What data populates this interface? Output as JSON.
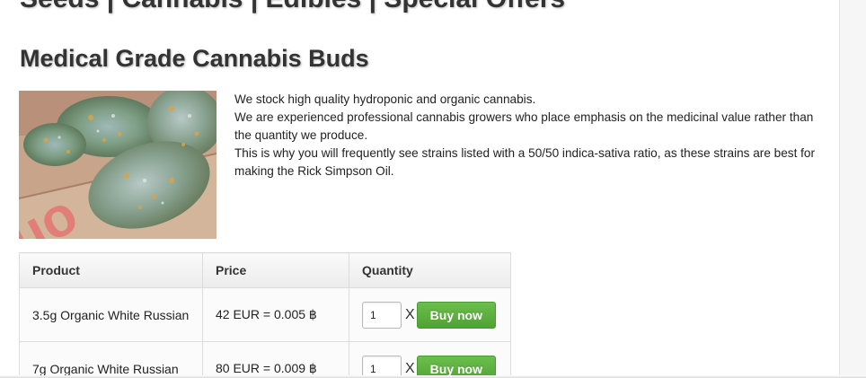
{
  "header": {
    "nav_text": "Seeds | Cannabis | Edibles | Special Offers"
  },
  "page": {
    "title": "Medical Grade Cannabis Buds"
  },
  "intro": {
    "line1": "We stock high quality hydroponic and organic cannabis.",
    "line2": "We are experienced professional cannabis growers who place emphasis on the medicinal value rather than the quantity we produce.",
    "line3": "This is why you will frequently see strains listed with a 50/50 indica-sativa ratio, as these strains are best for making the Rick Simpson Oil."
  },
  "table": {
    "headers": {
      "product": "Product",
      "price": "Price",
      "quantity": "Quantity"
    },
    "rows": [
      {
        "product": "3.5g Organic White Russian",
        "price": "42 EUR = 0.005 ฿",
        "quantity": "1",
        "multiplier": "X",
        "button": "Buy now"
      },
      {
        "product": "7g Organic White Russian",
        "price": "80 EUR = 0.009 ฿",
        "quantity": "1",
        "multiplier": "X",
        "button": "Buy now"
      }
    ]
  },
  "colors": {
    "buy_button": "#5cb13f",
    "heading_text": "#333333",
    "table_border": "#dcdcdc"
  }
}
